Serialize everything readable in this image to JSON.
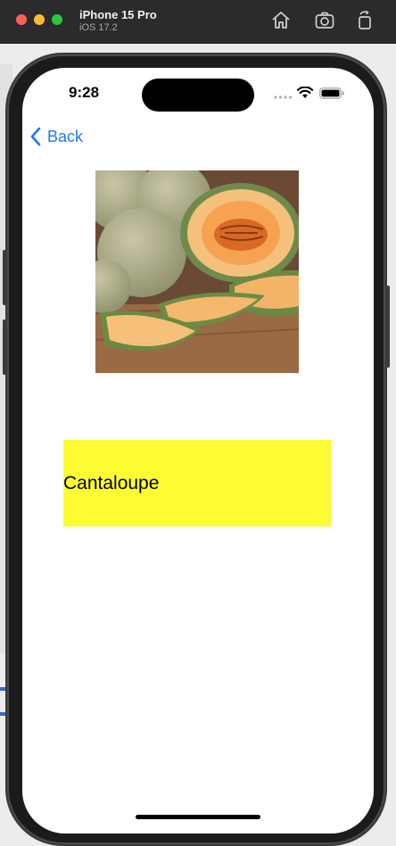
{
  "simulator": {
    "device_name": "iPhone 15 Pro",
    "os_version": "iOS 17.2",
    "toolbar_icons": [
      "home-icon",
      "screenshot-icon",
      "rotate-icon"
    ]
  },
  "status_bar": {
    "time": "9:28",
    "icons": [
      "signal-icon",
      "wifi-icon",
      "battery-icon"
    ]
  },
  "nav": {
    "back_label": "Back",
    "back_icon": "chevron-left-icon"
  },
  "content": {
    "image_subject": "cantaloupe",
    "fruit_name": "Cantaloupe",
    "name_box_color": "#fdfc33"
  },
  "colors": {
    "accent": "#1a7af0",
    "titlebar": "#2b2b2d"
  }
}
